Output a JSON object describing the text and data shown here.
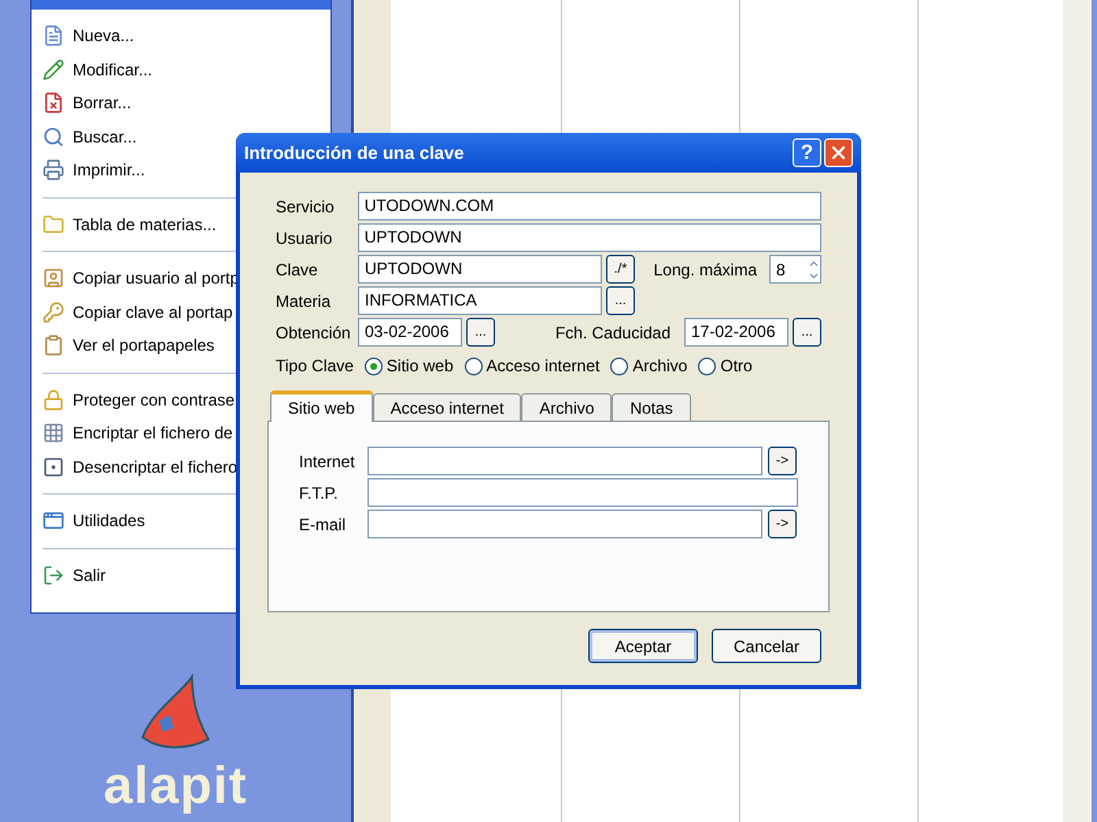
{
  "menu": {
    "groups": [
      [
        {
          "label": "Nueva..."
        },
        {
          "label": "Modificar..."
        },
        {
          "label": "Borrar..."
        },
        {
          "label": "Buscar..."
        },
        {
          "label": "Imprimir..."
        }
      ],
      [
        {
          "label": "Tabla de materias..."
        }
      ],
      [
        {
          "label": "Copiar usuario al portp"
        },
        {
          "label": "Copiar clave al portap"
        },
        {
          "label": "Ver el portapapeles"
        }
      ],
      [
        {
          "label": "Proteger con contrase"
        },
        {
          "label": "Encriptar el fichero de"
        },
        {
          "label": "Desencriptar el fichero"
        }
      ],
      [
        {
          "label": "Utilidades"
        }
      ],
      [
        {
          "label": "Salir"
        }
      ]
    ]
  },
  "logo": {
    "text": "alapit"
  },
  "dialog": {
    "title": "Introducción de una clave",
    "help_button": "?",
    "servicio": {
      "label": "Servicio",
      "value": "UTODOWN.COM"
    },
    "usuario": {
      "label": "Usuario",
      "value": "UPTODOWN"
    },
    "clave": {
      "label": "Clave",
      "value": "UPTODOWN",
      "button": "./*"
    },
    "long_maxima": {
      "label": "Long. máxima",
      "value": "8"
    },
    "materia": {
      "label": "Materia",
      "value": "INFORMATICA",
      "button": "..."
    },
    "obtencion": {
      "label": "Obtención",
      "value": "03-02-2006",
      "button": "..."
    },
    "caducidad": {
      "label": "Fch. Caducidad",
      "value": "17-02-2006",
      "button": "..."
    },
    "tipo_clave": {
      "label": "Tipo Clave",
      "options": [
        {
          "label": "Sitio web",
          "selected": true
        },
        {
          "label": "Acceso internet",
          "selected": false
        },
        {
          "label": "Archivo",
          "selected": false
        },
        {
          "label": "Otro",
          "selected": false
        }
      ]
    },
    "tabs": [
      {
        "label": "Sitio web",
        "selected": true
      },
      {
        "label": "Acceso internet",
        "selected": false
      },
      {
        "label": "Archivo",
        "selected": false
      },
      {
        "label": "Notas",
        "selected": false
      }
    ],
    "tab_fields": [
      {
        "label": "Internet",
        "button": "->"
      },
      {
        "label": "F.T.P."
      },
      {
        "label": "E-mail",
        "button": "->"
      }
    ],
    "buttons": [
      {
        "label": "Aceptar",
        "default": true
      },
      {
        "label": "Cancelar",
        "default": false
      }
    ]
  }
}
